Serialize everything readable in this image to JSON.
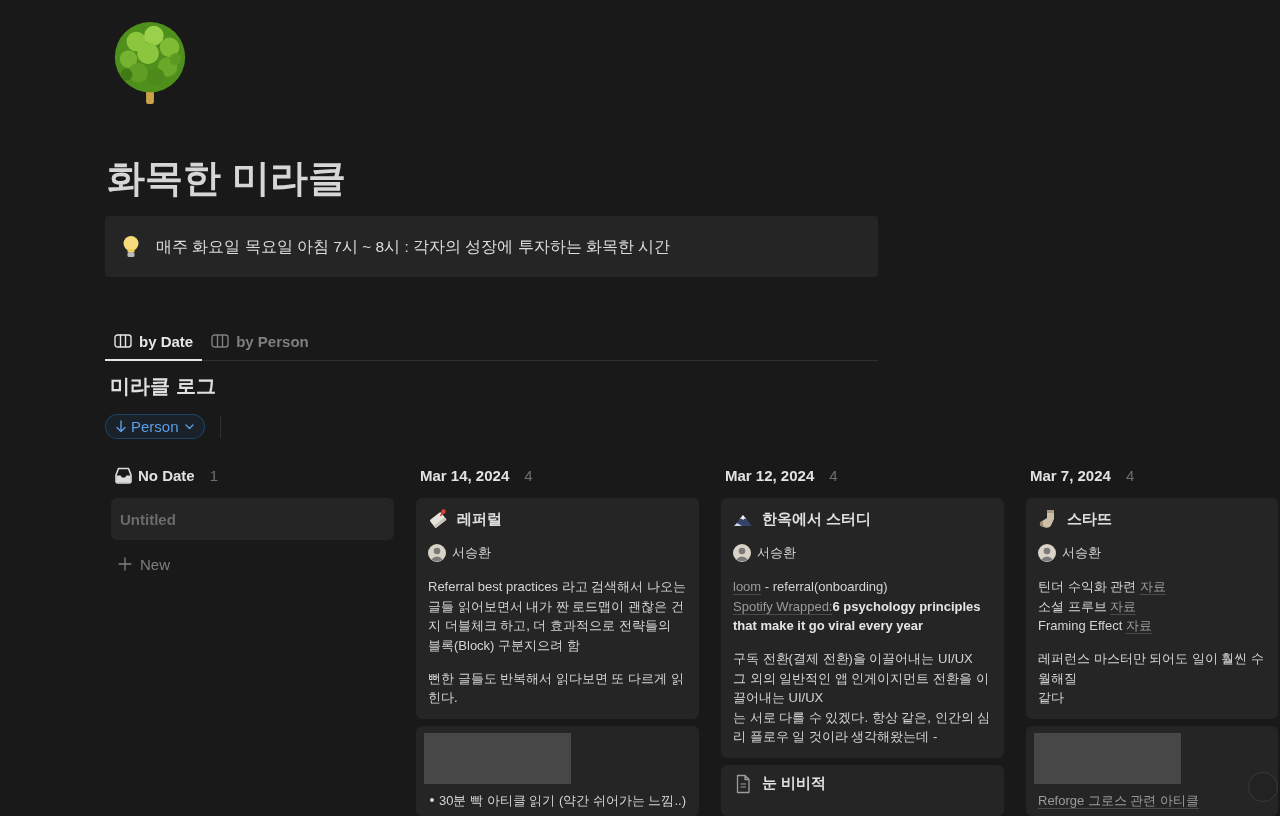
{
  "page": {
    "title": "화목한 미라클"
  },
  "callout": {
    "text": "매주 화요일 목요일 아침 7시 ~ 8시 : 각자의 성장에 투자하는 화목한 시간"
  },
  "tabs": [
    {
      "label": "by Date",
      "selected": true
    },
    {
      "label": "by Person",
      "selected": false
    }
  ],
  "database": {
    "title": "미라클 로그",
    "sort": {
      "label": "Person"
    }
  },
  "board": {
    "columns": [
      {
        "kind": "no_date",
        "title": "No Date",
        "count": "1",
        "cards": [
          {
            "kind": "untitled",
            "title": "Untitled"
          }
        ],
        "new_label": "New"
      },
      {
        "kind": "date",
        "title": "Mar 14, 2024",
        "count": "4",
        "cards": [
          {
            "kind": "page",
            "title": "레퍼럴",
            "person": "서승환",
            "paragraphs": [
              [
                {
                  "kind": "text",
                  "segments": [
                    {
                      "kind": "text",
                      "text": "Referral best practices 라고 검색해서 나오는 글들 읽어보면서 내가 짠 로드맵이 괜찮은 건지 더블체크 하고, 더 효과적으로 전략들의 블록(Block) 구분지으려 함"
                    }
                  ]
                }
              ],
              [
                {
                  "kind": "text",
                  "segments": [
                    {
                      "kind": "text",
                      "text": "뻔한 글들도 반복해서 읽다보면 또 다르게 읽힌다."
                    }
                  ]
                }
              ]
            ]
          },
          {
            "kind": "cover",
            "paragraphs": [
              [
                {
                  "kind": "bullet",
                  "segments": [
                    {
                      "kind": "text",
                      "text": "30분 빡 아티클 읽기 (약간 쉬어가는 느낌..)"
                    }
                  ]
                }
              ]
            ]
          }
        ]
      },
      {
        "kind": "date",
        "title": "Mar 12, 2024",
        "count": "4",
        "cards": [
          {
            "kind": "page",
            "title": "한옥에서 스터디",
            "person": "서승환",
            "paragraphs": [
              [
                {
                  "kind": "text",
                  "segments": [
                    {
                      "kind": "link",
                      "text": "loom"
                    },
                    {
                      "kind": "text",
                      "text": " - referral(onboarding)"
                    }
                  ]
                },
                {
                  "kind": "text",
                  "segments": [
                    {
                      "kind": "link",
                      "text": "Spotify Wrapped:"
                    },
                    {
                      "kind": "bold",
                      "text": "6 psychology principles that make it go viral every year"
                    }
                  ]
                }
              ],
              [
                {
                  "kind": "text",
                  "segments": [
                    {
                      "kind": "text",
                      "text": "구독 전환(결제 전환)을 이끌어내는 UI/UX"
                    }
                  ]
                },
                {
                  "kind": "text",
                  "segments": [
                    {
                      "kind": "text",
                      "text": "그 외의 일반적인 앱 인게이지먼트 전환을 이끌어내는 UI/UX"
                    }
                  ]
                },
                {
                  "kind": "text",
                  "segments": [
                    {
                      "kind": "text",
                      "text": "는 서로 다를 수 있겠다. 항상 같은, 인간의 심리 플로우 일 것이라 생각해왔는데 -"
                    }
                  ]
                }
              ]
            ]
          },
          {
            "kind": "plain_page",
            "title": "눈 비비적"
          }
        ]
      },
      {
        "kind": "date",
        "title": "Mar 7, 2024",
        "count": "4",
        "cards": [
          {
            "kind": "page",
            "title": "스타뜨",
            "person": "서승환",
            "paragraphs": [
              [
                {
                  "kind": "text",
                  "segments": [
                    {
                      "kind": "text",
                      "text": "틴더 수익화 관련 "
                    },
                    {
                      "kind": "link",
                      "text": "자료"
                    }
                  ]
                },
                {
                  "kind": "text",
                  "segments": [
                    {
                      "kind": "text",
                      "text": "소셜 프루브 "
                    },
                    {
                      "kind": "link",
                      "text": "자료"
                    }
                  ]
                },
                {
                  "kind": "text",
                  "segments": [
                    {
                      "kind": "text",
                      "text": "Framing Effect "
                    },
                    {
                      "kind": "link",
                      "text": "자료"
                    }
                  ]
                }
              ],
              [
                {
                  "kind": "text",
                  "segments": [
                    {
                      "kind": "text",
                      "text": "레퍼런스 마스터만 되어도 일이 훨씬 수월해질"
                    }
                  ]
                },
                {
                  "kind": "text",
                  "segments": [
                    {
                      "kind": "text",
                      "text": "같다"
                    }
                  ]
                }
              ]
            ]
          },
          {
            "kind": "cover",
            "paragraphs": [
              [
                {
                  "kind": "text",
                  "segments": [
                    {
                      "kind": "link",
                      "text": "Reforge 그로스 관련 아티클"
                    }
                  ]
                }
              ]
            ]
          }
        ]
      }
    ]
  }
}
